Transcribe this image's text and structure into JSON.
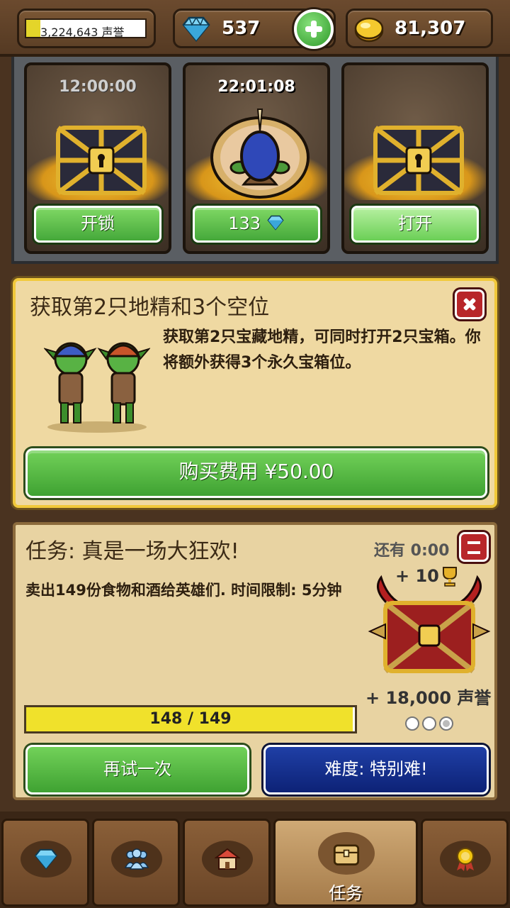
{
  "resources": {
    "reputation": "3,224,643 声誉",
    "reputation_fill": 0.12,
    "gems": "537",
    "gold": "81,307"
  },
  "chest_slots": [
    {
      "timer": "12:00:00",
      "button": "开锁"
    },
    {
      "timer": "22:01:08",
      "button": "133"
    },
    {
      "timer": "",
      "button": "打开"
    }
  ],
  "offer": {
    "title": "获取第2只地精和3个空位",
    "description": "获取第2只宝藏地精，可同时打开2只宝箱。你将额外获得3个永久宝箱位。",
    "buy_button": "购买费用 ¥50.00"
  },
  "quest": {
    "title": "任务: 真是一场大狂欢!",
    "timer": "还有 0:00",
    "description": "卖出149份食物和酒给英雄们. 时间限制: 5分钟",
    "reward_trophies": "+ 10",
    "reward_reputation": "+ 18,000 声誉",
    "progress_text": "148 / 149",
    "progress_fraction": 0.993,
    "retry_button": "再试一次",
    "difficulty_button": "难度: 特别难!"
  },
  "nav": {
    "tabs": [
      {
        "icon": "gem-icon",
        "label": ""
      },
      {
        "icon": "heroes-icon",
        "label": ""
      },
      {
        "icon": "tavern-icon",
        "label": ""
      },
      {
        "icon": "chest-icon",
        "label": "任务",
        "active": true
      },
      {
        "icon": "medal-icon",
        "label": ""
      }
    ]
  },
  "colors": {
    "button_green": "#45a83a",
    "difficulty_blue": "#0d2276",
    "close_red": "#b8262a",
    "progress_yellow": "#f0e12b"
  }
}
